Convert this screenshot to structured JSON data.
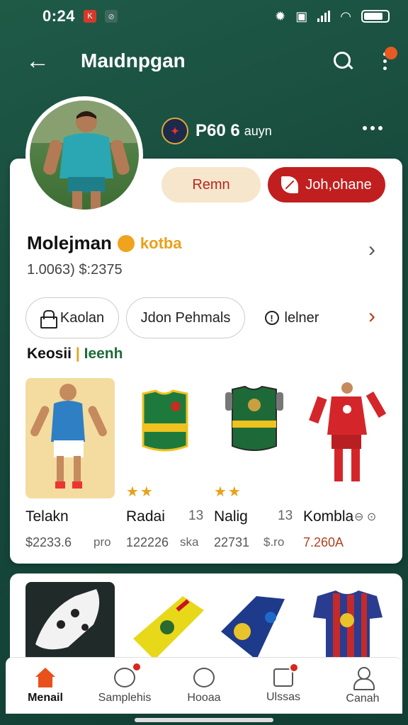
{
  "status_bar": {
    "time": "0:24"
  },
  "app_bar": {
    "title": "Maıdnpgan"
  },
  "club": {
    "name": "P60 6",
    "sub": "auyn"
  },
  "actions": {
    "remn_label": "Remn",
    "join_label": "Joh,ohane"
  },
  "profile": {
    "name": "Molejman",
    "badge_text": "kotba",
    "stats": "1.0063) $:2375"
  },
  "chips": [
    {
      "label": "Kaolan"
    },
    {
      "label": "Jdon Pehmals"
    },
    {
      "label": "lelner"
    }
  ],
  "section": {
    "title_left": "Keosii",
    "title_sep": "|",
    "title_right": "Ieenh"
  },
  "products": [
    {
      "name": "Telakn",
      "count": "",
      "price": "$2233.6",
      "unit": "pro",
      "stars": ""
    },
    {
      "name": "Radai",
      "count": "13",
      "price": "122226",
      "unit": "ska",
      "stars": "★★"
    },
    {
      "name": "Nalig",
      "count": "13",
      "price": "22731",
      "unit": "$.ro",
      "stars": "★★"
    },
    {
      "name": "Kombla",
      "count": "",
      "price": "7.260A",
      "unit": "",
      "stars": ""
    }
  ],
  "nav": [
    {
      "label": "Menail",
      "icon": "home-icon",
      "active": true
    },
    {
      "label": "Samplehis",
      "icon": "chat-icon"
    },
    {
      "label": "Hooaa",
      "icon": "pin-icon"
    },
    {
      "label": "Ulssas",
      "icon": "message-icon"
    },
    {
      "label": "Canah",
      "icon": "user-icon"
    }
  ],
  "colors": {
    "brand_green": "#1f5a47",
    "accent_red": "#c11f1f",
    "accent_orange": "#e8501c",
    "gold": "#e8a11a"
  }
}
